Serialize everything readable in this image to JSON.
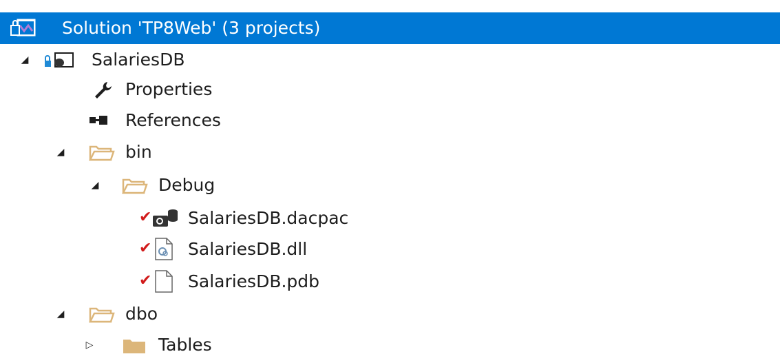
{
  "solution": {
    "label": "Solution 'TP8Web' (3 projects)",
    "icon": "solution-icon"
  },
  "tree": {
    "project": {
      "label": "SalariesDB",
      "toggle": "◢",
      "icon": "db-project-icon"
    },
    "properties": {
      "label": "Properties",
      "icon": "wrench-icon"
    },
    "references": {
      "label": "References",
      "icon": "references-icon"
    },
    "bin": {
      "label": "bin",
      "toggle": "◢",
      "icon": "folder-open-icon"
    },
    "debug": {
      "label": "Debug",
      "toggle": "◢",
      "icon": "folder-open-icon"
    },
    "dacpac": {
      "label": "SalariesDB.dacpac",
      "check": "✔",
      "icon": "dacpac-icon"
    },
    "dll": {
      "label": "SalariesDB.dll",
      "check": "✔",
      "icon": "dll-icon"
    },
    "pdb": {
      "label": "SalariesDB.pdb",
      "check": "✔",
      "icon": "file-icon"
    },
    "dbo": {
      "label": "dbo",
      "toggle": "◢",
      "icon": "folder-open-icon"
    },
    "tables": {
      "label": "Tables",
      "toggle": "▷",
      "icon": "folder-closed-icon"
    }
  },
  "colors": {
    "selection": "#0078d4",
    "folder": "#dcb67a",
    "check": "#d11a1a"
  }
}
